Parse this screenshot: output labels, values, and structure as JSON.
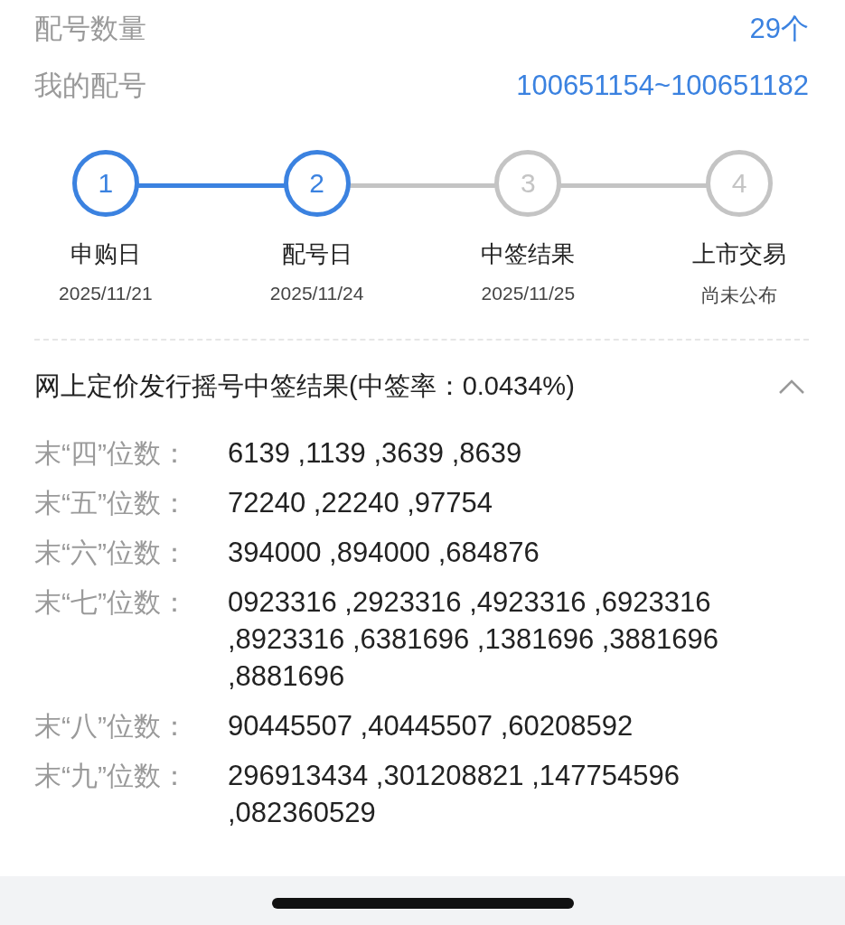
{
  "info_rows": [
    {
      "label": "配号数量",
      "value": "29个"
    },
    {
      "label": "我的配号",
      "value": "100651154~100651182"
    }
  ],
  "steps": [
    {
      "number": "1",
      "label": "申购日",
      "date": "2025/11/21",
      "active": true
    },
    {
      "number": "2",
      "label": "配号日",
      "date": "2025/11/24",
      "active": true
    },
    {
      "number": "3",
      "label": "中签结果",
      "date": "2025/11/25",
      "active": false
    },
    {
      "number": "4",
      "label": "上市交易",
      "date": "尚未公布",
      "active": false
    }
  ],
  "result_section": {
    "title": "网上定价发行摇号中签结果(中签率：0.0434%)",
    "expanded": true,
    "rows": [
      {
        "label": "末“四”位数：",
        "numbers": "6139 ,1139 ,3639 ,8639"
      },
      {
        "label": "末“五”位数：",
        "numbers": "72240 ,22240 ,97754"
      },
      {
        "label": "末“六”位数：",
        "numbers": "394000 ,894000 ,684876"
      },
      {
        "label": "末“七”位数：",
        "numbers": "0923316 ,2923316 ,4923316 ,6923316 ,8923316 ,6381696 ,1381696 ,3881696 ,8881696"
      },
      {
        "label": "末“八”位数：",
        "numbers": "90445507 ,40445507 ,60208592"
      },
      {
        "label": "末“九”位数：",
        "numbers": "296913434 ,301208821 ,147754596 ,082360529"
      }
    ]
  }
}
